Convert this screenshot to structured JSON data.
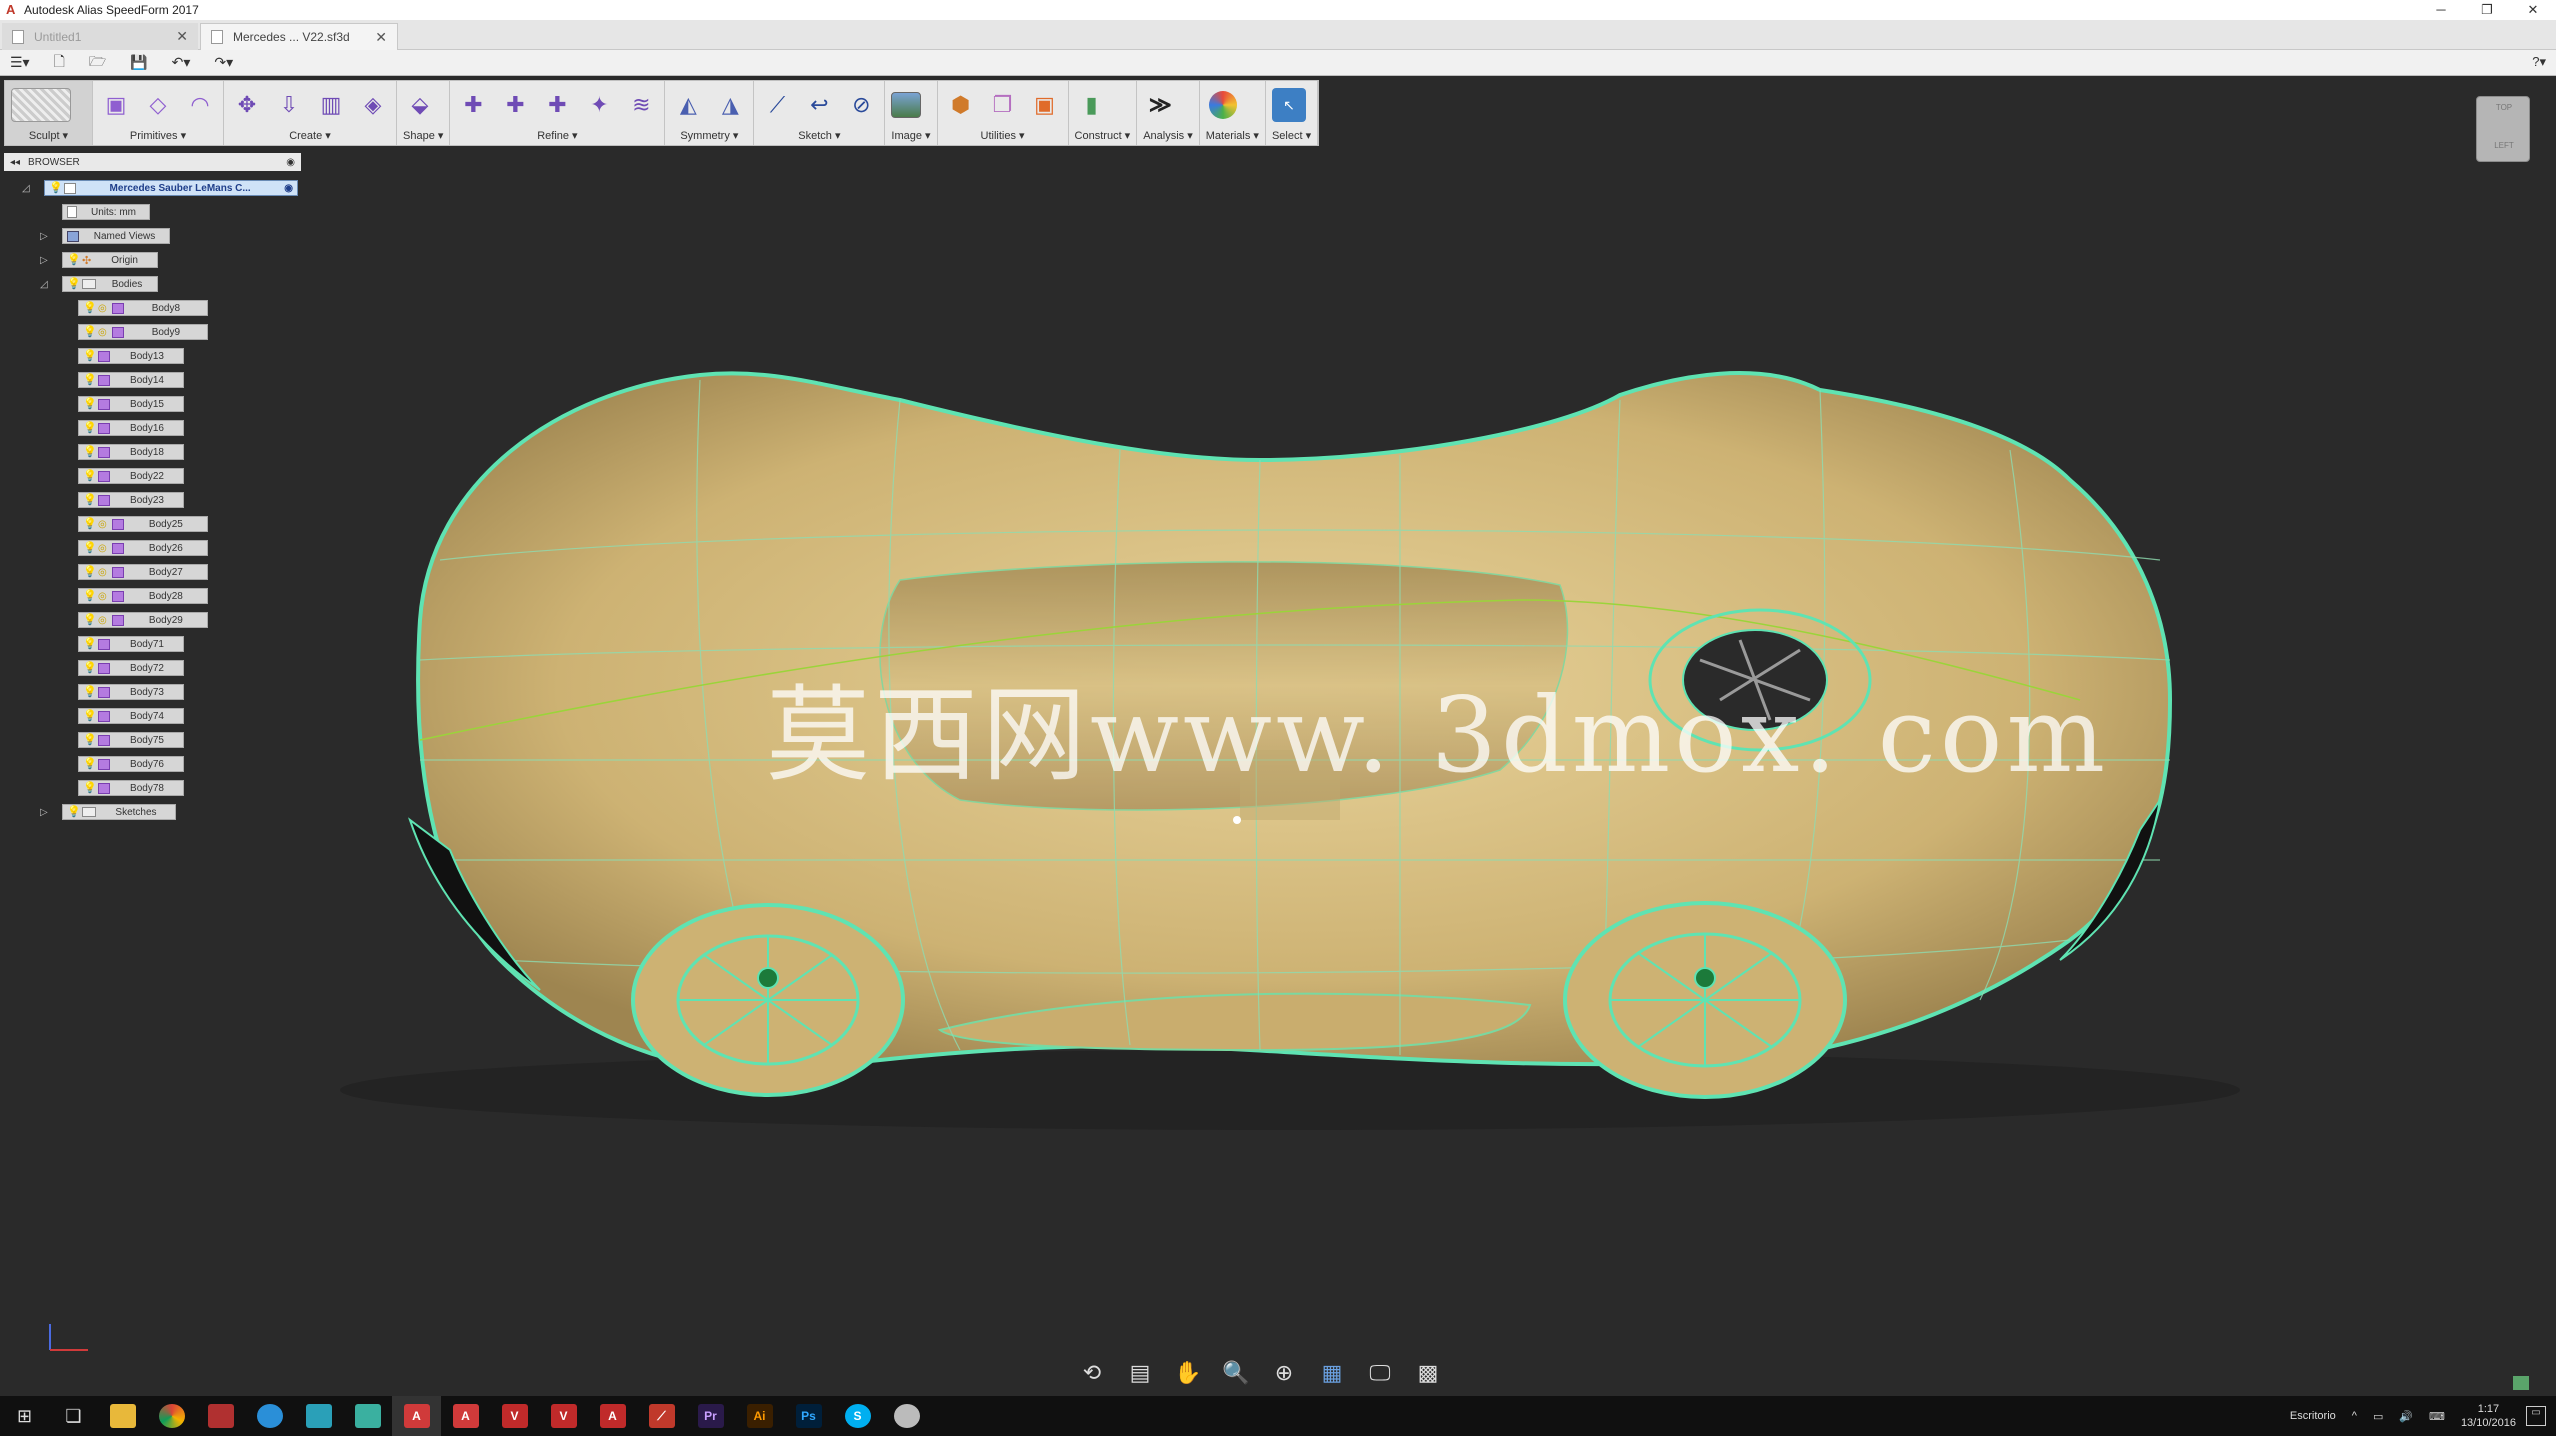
{
  "window": {
    "title": "Autodesk Alias SpeedForm 2017"
  },
  "tabs": [
    {
      "label": "Untitled1"
    },
    {
      "label": "Mercedes ... V22.sf3d"
    }
  ],
  "ribbon_groups": [
    {
      "label": "Sculpt ▾"
    },
    {
      "label": "Primitives ▾"
    },
    {
      "label": "Create ▾"
    },
    {
      "label": "Shape ▾"
    },
    {
      "label": "Refine ▾"
    },
    {
      "label": "Symmetry ▾"
    },
    {
      "label": "Sketch ▾"
    },
    {
      "label": "Image ▾"
    },
    {
      "label": "Utilities ▾"
    },
    {
      "label": "Construct ▾"
    },
    {
      "label": "Analysis ▾"
    },
    {
      "label": "Materials ▾"
    },
    {
      "label": "Select ▾"
    }
  ],
  "browser": {
    "title": "BROWSER",
    "root": "Mercedes Sauber LeMans C...",
    "units": "Units: mm",
    "named_views": "Named Views",
    "origin": "Origin",
    "bodies": "Bodies",
    "sketches": "Sketches",
    "body_items": [
      "Body8",
      "Body9",
      "Body13",
      "Body14",
      "Body15",
      "Body16",
      "Body18",
      "Body22",
      "Body23",
      "Body25",
      "Body26",
      "Body27",
      "Body28",
      "Body29",
      "Body71",
      "Body72",
      "Body73",
      "Body74",
      "Body75",
      "Body76",
      "Body78"
    ]
  },
  "navcube": {
    "top": "TOP",
    "left": "LEFT"
  },
  "watermark": "莫西网www. 3dmox. com",
  "taskbar": {
    "apps": [
      "Pr",
      "Ai",
      "Ps"
    ],
    "language": "Escritorio",
    "time": "1:17",
    "date": "13/10/2016"
  },
  "colors": {
    "viewport_bg": "#2a2a2a",
    "model_surface": "#d8c084",
    "edge_highlight": "#5fe3b2",
    "ribbon_bg": "#e9e9e9"
  }
}
